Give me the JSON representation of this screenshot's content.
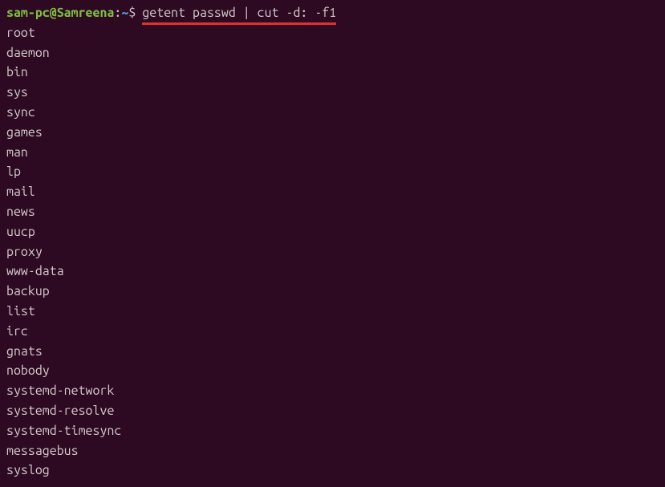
{
  "prompt": {
    "user_host": "sam-pc@Samreena",
    "colon": ":",
    "path": "~",
    "dollar": "$"
  },
  "command": "getent passwd | cut -d: -f1",
  "output": [
    "root",
    "daemon",
    "bin",
    "sys",
    "sync",
    "games",
    "man",
    "lp",
    "mail",
    "news",
    "uucp",
    "proxy",
    "www-data",
    "backup",
    "list",
    "irc",
    "gnats",
    "nobody",
    "systemd-network",
    "systemd-resolve",
    "systemd-timesync",
    "messagebus",
    "syslog"
  ]
}
